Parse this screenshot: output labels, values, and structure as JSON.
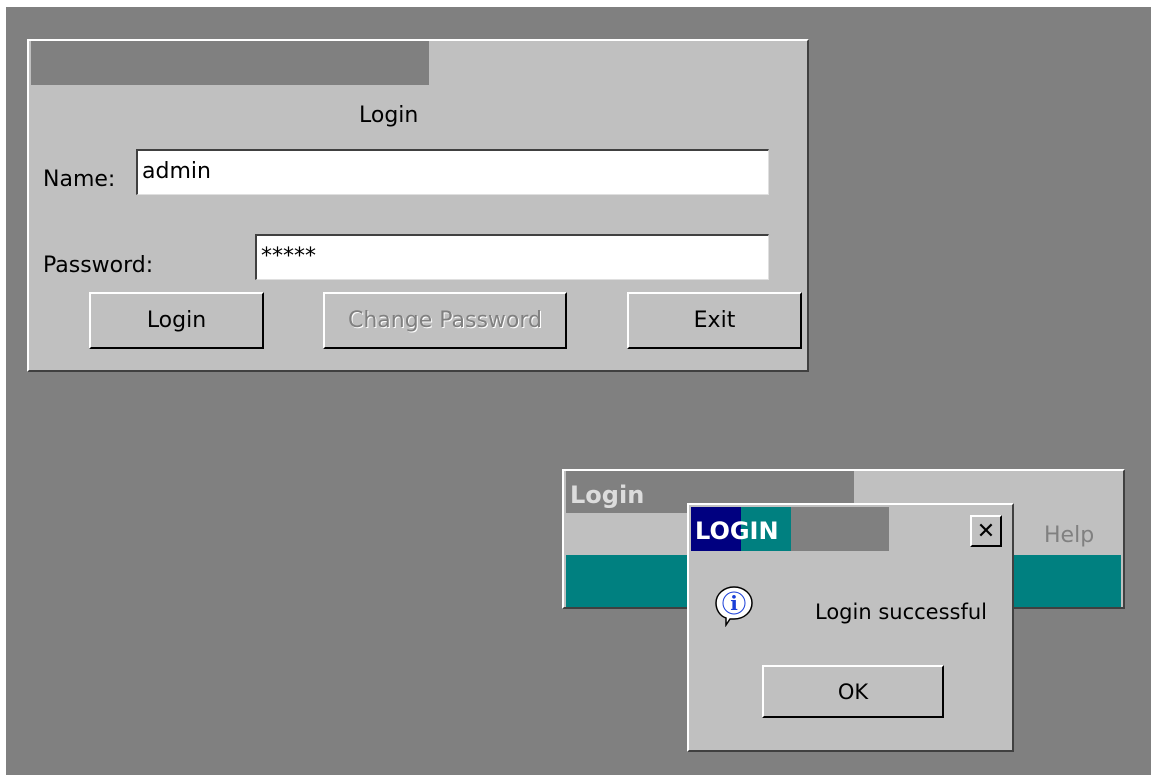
{
  "main_window": {
    "heading": "Login",
    "name_label": "Name:",
    "name_value": "admin",
    "password_label": "Password:",
    "password_value": "*****",
    "login_button": "Login",
    "change_password_button": "Change Password",
    "exit_button": "Exit"
  },
  "app_window": {
    "title": "Login",
    "help_label": "Help"
  },
  "message_box": {
    "title": "LOGIN",
    "close_icon": "close-icon",
    "message": "Login successful",
    "ok_button": "OK",
    "icon": "info-icon"
  },
  "colors": {
    "desktop": "#808080",
    "window": "#c0c0c0",
    "teal": "#008080",
    "navy": "#000080"
  }
}
